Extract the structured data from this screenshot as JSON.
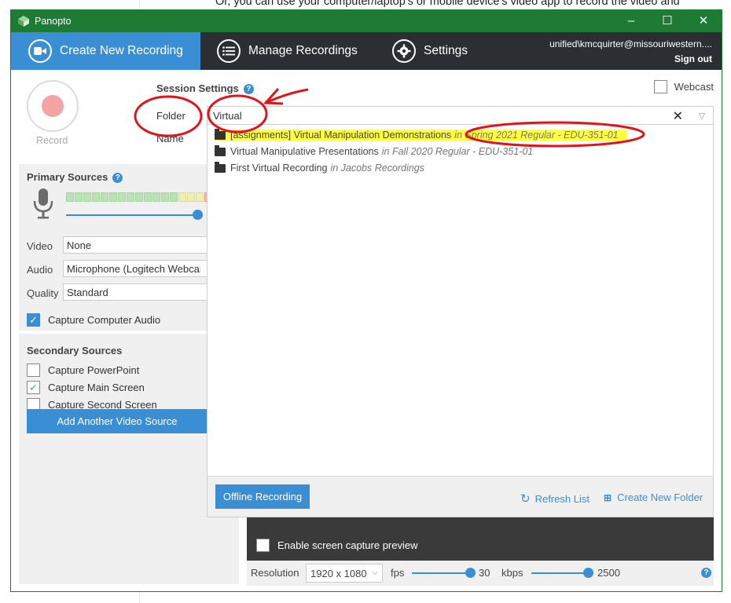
{
  "background_doc": {
    "text": "Or, you can use your computer/laptop's or mobile device's video app to record the video and"
  },
  "window": {
    "title": "Panopto",
    "controls": [
      "–",
      "☐",
      "✕"
    ]
  },
  "nav": {
    "tabs": [
      {
        "label": "Create New Recording",
        "icon": "video-camera-icon",
        "active": true
      },
      {
        "label": "Manage Recordings",
        "icon": "list-icon",
        "active": false
      },
      {
        "label": "Settings",
        "icon": "gear-icon",
        "active": false
      }
    ],
    "user": "unified\\kmcquirter@missouriwestern....",
    "sign_out": "Sign out"
  },
  "record": {
    "label": "Record"
  },
  "session": {
    "title": "Session Settings",
    "webcast": "Webcast",
    "folder_label": "Folder",
    "name_label": "Name",
    "folder_value": "Virtual"
  },
  "primary": {
    "title": "Primary Sources",
    "video_label": "Video",
    "video_value": "None",
    "audio_label": "Audio",
    "audio_value": "Microphone (Logitech Webcam",
    "quality_label": "Quality",
    "quality_value": "Standard",
    "capture_computer_audio": "Capture Computer Audio",
    "capture_computer_audio_checked": true
  },
  "secondary": {
    "title": "Secondary Sources",
    "items": [
      {
        "label": "Capture PowerPoint",
        "checked": false
      },
      {
        "label": "Capture Main Screen",
        "checked": true
      },
      {
        "label": "Capture Second Screen",
        "checked": false
      }
    ],
    "add_button": "Add Another Video Source"
  },
  "dropdown": {
    "items": [
      {
        "name": "[assignments] Virtual Manipulation Demonstrations",
        "context": "in Spring 2021 Regular - EDU-351-01",
        "highlighted": true
      },
      {
        "name": "Virtual Manipulative Presentations",
        "context": "in Fall 2020 Regular - EDU-351-01",
        "highlighted": false
      },
      {
        "name": "First Virtual Recording",
        "context": "in Jacobs Recordings",
        "highlighted": false
      }
    ],
    "offline_button": "Offline Recording",
    "refresh": "Refresh List",
    "new_folder": "Create New Folder"
  },
  "preview": {
    "enable_label": "Enable screen capture preview",
    "resolution_label": "Resolution",
    "resolution_value": "1920 x 1080",
    "fps_label": "fps",
    "fps_value": "30",
    "kbps_label": "kbps",
    "kbps_value": "2500"
  },
  "colors": {
    "accent": "#3a8fd4",
    "titlebar": "#1e7b34",
    "nav_bg": "#2b2f33",
    "annotation": "#e0141b",
    "highlight": "#ffff3c"
  }
}
